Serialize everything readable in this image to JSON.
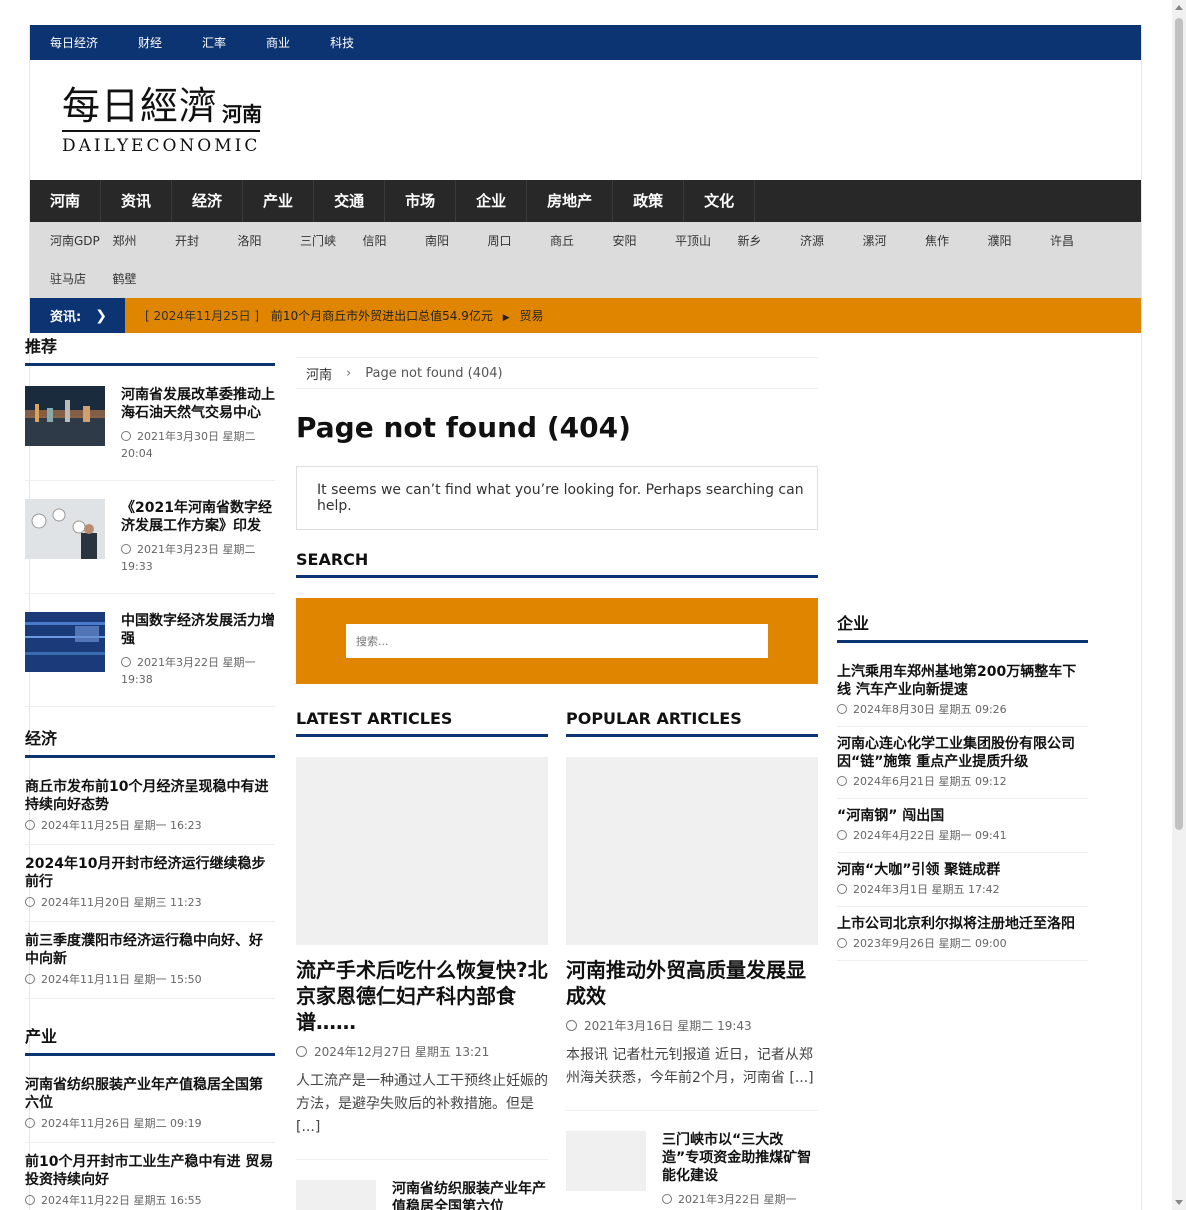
{
  "topbar": [
    "每日经济",
    "财经",
    "汇率",
    "商业",
    "科技"
  ],
  "logo": {
    "cn": "每日經濟",
    "region": "河南",
    "en": "DAILYECONOMIC"
  },
  "mainnav": [
    "河南",
    "资讯",
    "经济",
    "产业",
    "交通",
    "市场",
    "企业",
    "房地产",
    "政策",
    "文化"
  ],
  "subnav": [
    "河南GDP",
    "郑州",
    "开封",
    "洛阳",
    "三门峡",
    "信阳",
    "南阳",
    "周口",
    "商丘",
    "安阳",
    "平顶山",
    "新乡",
    "济源",
    "漯河",
    "焦作",
    "濮阳",
    "许昌",
    "驻马店",
    "鹤壁"
  ],
  "ticker": {
    "label": "资讯:",
    "date": "[ 2024年11月25日 ]",
    "text": "前10个月商丘市外贸进出口总值54.9亿元",
    "category": "贸易"
  },
  "left": {
    "recommend_title": "推荐",
    "recommend": [
      {
        "title": "河南省发展改革委推动上海石油天然气交易中心",
        "meta": "2021年3月30日 星期二 20:04",
        "thumb": "city-night"
      },
      {
        "title": "《2021年河南省数字经济发展工作方案》印发",
        "meta": "2021年3月23日 星期二 19:33",
        "thumb": "cctv-cameras"
      },
      {
        "title": "中国数字经济发展活力增强",
        "meta": "2021年3月22日 星期一 19:38",
        "thumb": "data-screen"
      }
    ],
    "economy_title": "经济",
    "economy": [
      {
        "title": "商丘市发布前10个月经济呈现稳中有进持续向好态势",
        "meta": "2024年11月25日 星期一 16:23"
      },
      {
        "title": "2024年10月开封市经济运行继续稳步前行",
        "meta": "2024年11月20日 星期三 11:23"
      },
      {
        "title": "前三季度濮阳市经济运行稳中向好、好中向新",
        "meta": "2024年11月11日 星期一 15:50"
      }
    ],
    "industry_title": "产业",
    "industry": [
      {
        "title": "河南省纺织服装产业年产值稳居全国第六位",
        "meta": "2024年11月26日 星期二 09:19"
      },
      {
        "title": "前10个月开封市工业生产稳中有进 贸易投资持续向好",
        "meta": "2024年11月22日 星期五 16:55"
      }
    ]
  },
  "main": {
    "breadcrumb_home": "河南",
    "breadcrumb_current": "Page not found (404)",
    "title": "Page not found (404)",
    "message": "It seems we can’t find what you’re looking for. Perhaps searching can help.",
    "search_title": "SEARCH",
    "search_placeholder": "搜索...",
    "latest_title": "LATEST ARTICLES",
    "popular_title": "POPULAR ARTICLES",
    "latest": {
      "title": "流产手术后吃什么恢复快?北京家恩德仁妇产科内部食谱……",
      "meta": "2024年12月27日 星期五 13:21",
      "excerpt": "人工流产是一种通过人工干预终止妊娠的方法，是避孕失败后的补救措施。但是 [...]",
      "small_title": "河南省纺织服装产业年产值稳居全国第六位"
    },
    "popular": {
      "title": "河南推动外贸高质量发展显成效",
      "meta": "2021年3月16日 星期二 19:43",
      "excerpt": "本报讯 记者杜元钊报道 近日，记者从郑州海关获悉，今年前2个月，河南省 [...]",
      "small_title": "三门峡市以“三大改造”专项资金助推煤矿智能化建设",
      "small_meta": "2021年3月22日 星期一"
    }
  },
  "right": {
    "title": "企业",
    "items": [
      {
        "title": "上汽乘用车郑州基地第200万辆整车下线 汽车产业向新提速",
        "meta": "2024年8月30日 星期五 09:26"
      },
      {
        "title": "河南心连心化学工业集团股份有限公司因“链”施策 重点产业提质升级",
        "meta": "2024年6月21日 星期五 09:12"
      },
      {
        "title": "“河南钢” 闯出国",
        "meta": "2024年4月22日 星期一 09:41"
      },
      {
        "title": "河南“大咖”引领 聚链成群",
        "meta": "2024年3月1日 星期五 17:42"
      },
      {
        "title": "上市公司北京利尔拟将注册地迁至洛阳",
        "meta": "2023年9月26日 星期二 09:00"
      }
    ]
  },
  "colors": {
    "navy": "#0c3472",
    "orange": "#e08500",
    "dark_nav": "#282828",
    "subnav_bg": "#dcdcdc"
  }
}
